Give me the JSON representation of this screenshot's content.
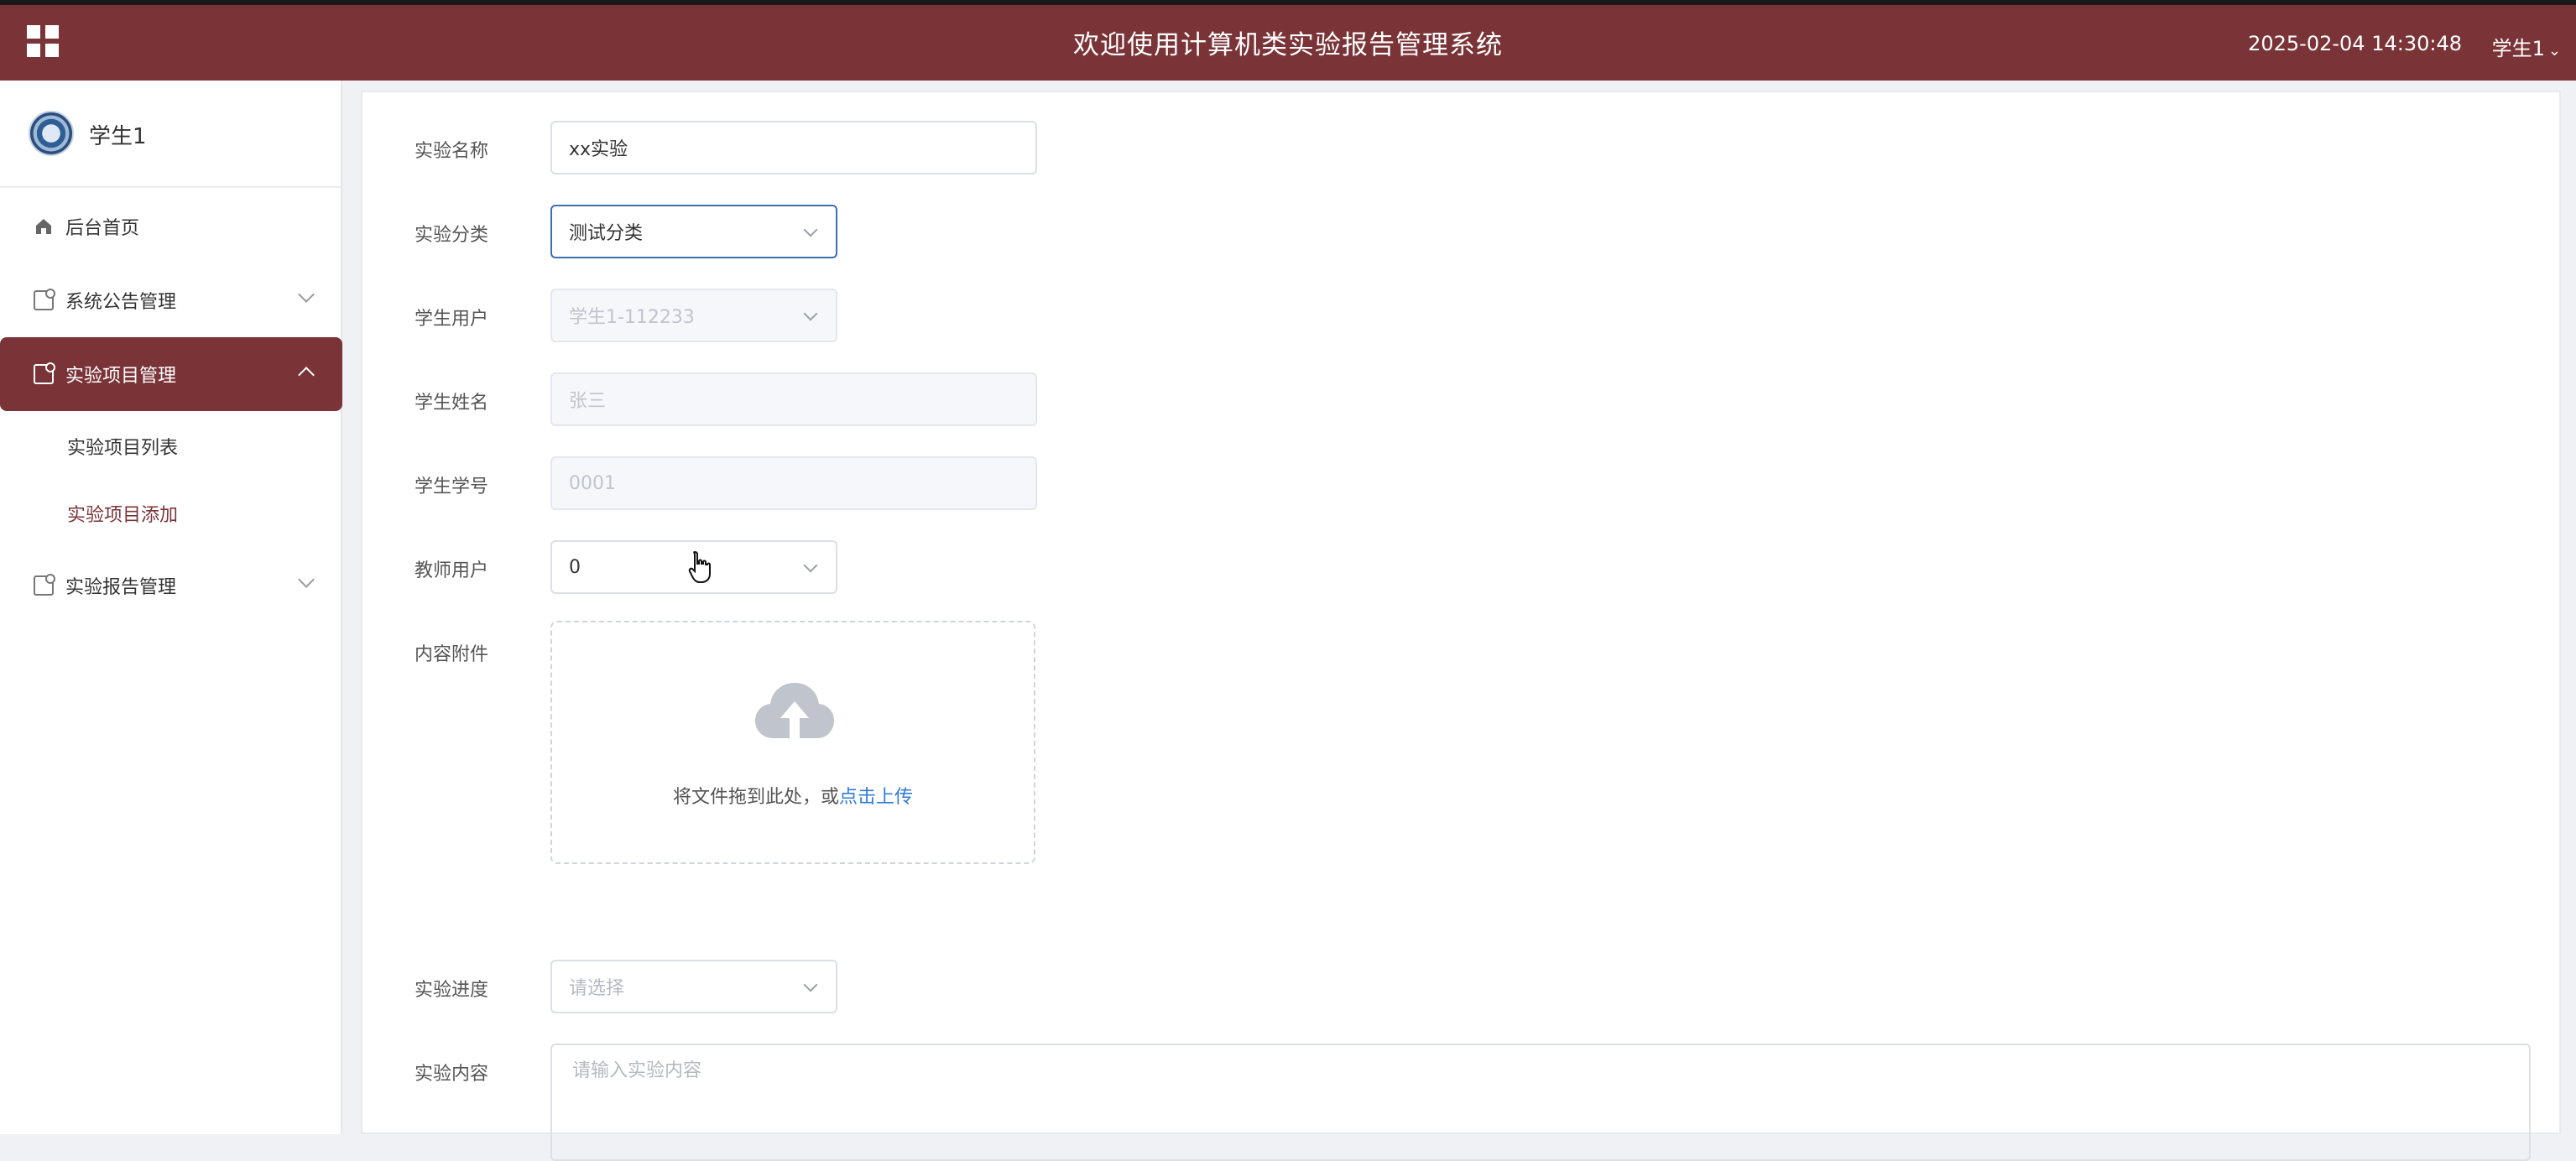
{
  "header": {
    "title": "欢迎使用计算机类实验报告管理系统",
    "datetime": "2025-02-04 14:30:48",
    "user": "学生1"
  },
  "sidebar": {
    "profile_name": "学生1",
    "items": [
      {
        "label": "后台首页"
      },
      {
        "label": "系统公告管理"
      },
      {
        "label": "实验项目管理"
      },
      {
        "label": "实验报告管理"
      }
    ],
    "subitems": [
      {
        "label": "实验项目列表"
      },
      {
        "label": "实验项目添加"
      }
    ]
  },
  "form": {
    "name_label": "实验名称",
    "name_value": "xx实验",
    "category_label": "实验分类",
    "category_value": "测试分类",
    "student_user_label": "学生用户",
    "student_user_value": "学生1-112233",
    "student_name_label": "学生姓名",
    "student_name_value": "张三",
    "student_id_label": "学生学号",
    "student_id_value": "0001",
    "teacher_user_label": "教师用户",
    "teacher_user_value": "0",
    "attachment_label": "内容附件",
    "upload_text": "将文件拖到此处，或",
    "upload_link": "点击上传",
    "progress_label": "实验进度",
    "progress_placeholder": "请选择",
    "content_label": "实验内容",
    "content_placeholder": "请输入实验内容"
  },
  "colors": {
    "brand": "#7a3438",
    "link": "#2f7bd8"
  }
}
